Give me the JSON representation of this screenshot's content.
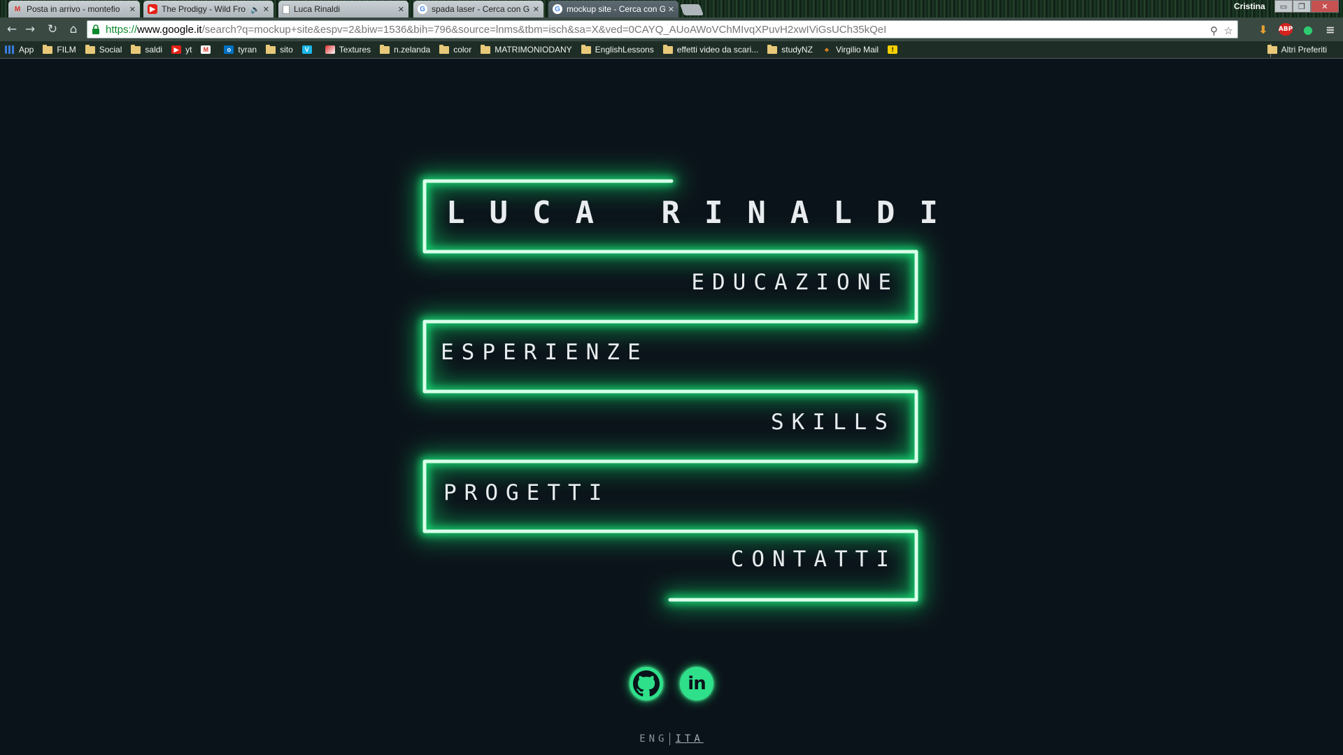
{
  "browser": {
    "tabs": [
      {
        "title": "Posta in arrivo - montefio",
        "favicon": "gmail-icon",
        "active": false
      },
      {
        "title": "The Prodigy - Wild Fro",
        "favicon": "youtube-icon",
        "active": false,
        "audio": true
      },
      {
        "title": "Luca Rinaldi",
        "favicon": "page-icon",
        "active": false
      },
      {
        "title": "spada laser - Cerca con G",
        "favicon": "google-icon",
        "active": false
      },
      {
        "title": "mockup site - Cerca con G",
        "favicon": "google-icon",
        "active": true
      }
    ],
    "profile_name": "Cristina",
    "url": {
      "scheme": "https://",
      "host": "www.google.it",
      "rest": "/search?q=mockup+site&espv=2&biw=1536&bih=796&source=lnms&tbm=isch&sa=X&ved=0CAYQ_AUoAWoVChMIvqXPuvH2xwIViGsUCh35kQeI"
    },
    "bookmarks": [
      {
        "label": "App",
        "icon": "apps-grid-icon"
      },
      {
        "label": "FILM",
        "icon": "folder-icon"
      },
      {
        "label": "Social",
        "icon": "folder-icon"
      },
      {
        "label": "saldi",
        "icon": "folder-icon"
      },
      {
        "label": "yt",
        "icon": "youtube-icon"
      },
      {
        "label": "",
        "icon": "gmail-icon"
      },
      {
        "label": "tyran",
        "icon": "outlook-icon"
      },
      {
        "label": "sito",
        "icon": "folder-icon"
      },
      {
        "label": "",
        "icon": "vimeo-icon"
      },
      {
        "label": "Textures",
        "icon": "texture-icon"
      },
      {
        "label": "n.zelanda",
        "icon": "folder-icon"
      },
      {
        "label": "color",
        "icon": "folder-icon"
      },
      {
        "label": "MATRIMONIODANY",
        "icon": "folder-icon"
      },
      {
        "label": "EnglishLessons",
        "icon": "folder-icon"
      },
      {
        "label": "effetti video da scari...",
        "icon": "folder-icon"
      },
      {
        "label": "studyNZ",
        "icon": "folder-icon"
      },
      {
        "label": "Virgilio Mail",
        "icon": "virgilio-icon"
      },
      {
        "label": "",
        "icon": "warning-icon"
      }
    ],
    "other_bookmarks": "Altri Preferiti",
    "extensions": [
      "download-icon",
      "adblock-icon",
      "green-shield-icon",
      "menu-icon"
    ]
  },
  "site": {
    "title": "LUCA RINALDI",
    "nav": {
      "educazione": "EDUCAZIONE",
      "esperienze": "ESPERIENZE",
      "skills": "SKILLS",
      "progetti": "PROGETTI",
      "contatti": "CONTATTI"
    },
    "social": [
      "github-icon",
      "linkedin-icon"
    ],
    "linkedin_glyph": "in",
    "lang": {
      "eng": "ENG",
      "ita": "ITA",
      "active": "ITA"
    },
    "accent_color": "#19e27a",
    "background_color": "#0b131a"
  }
}
